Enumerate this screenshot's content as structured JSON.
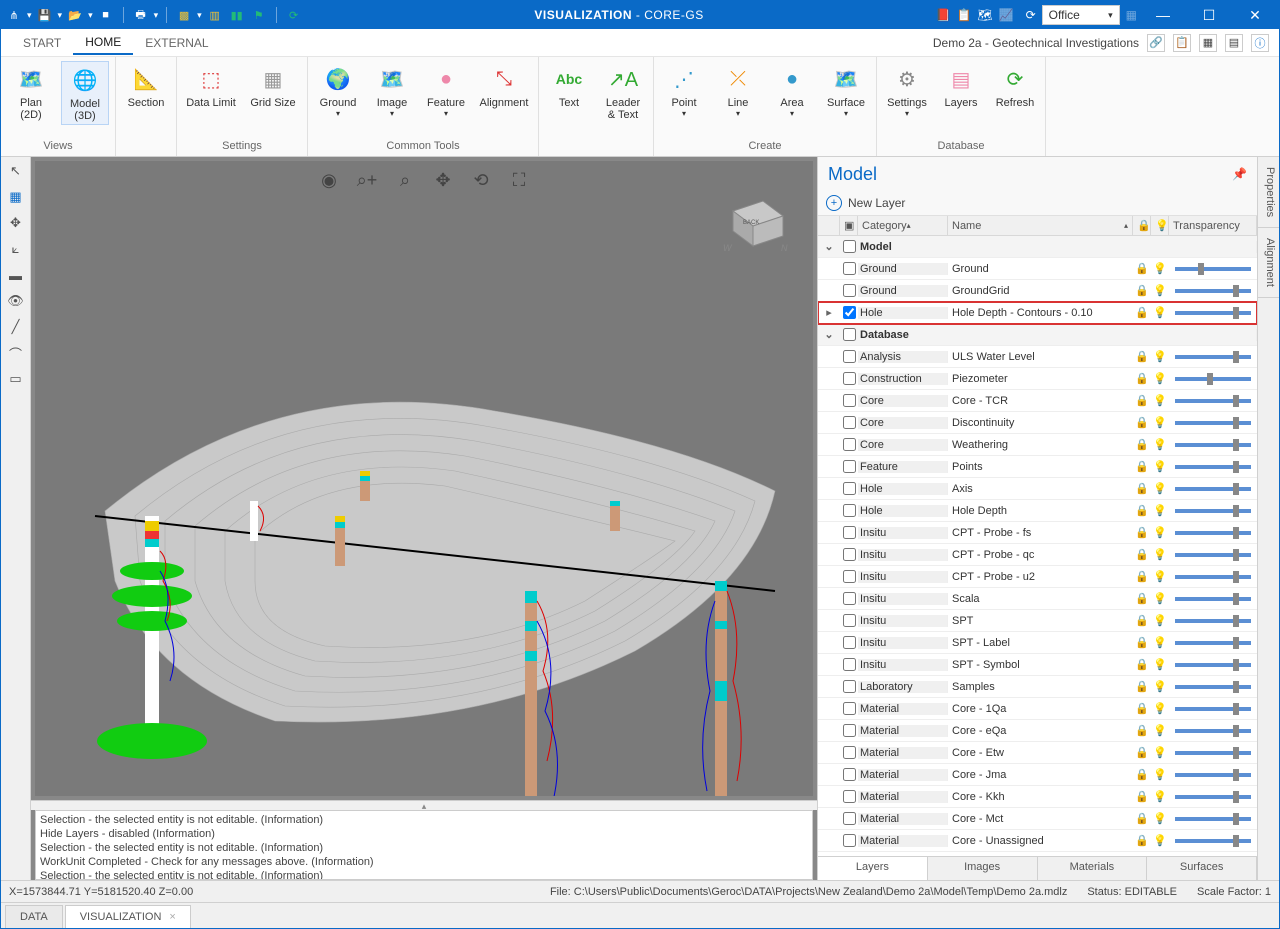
{
  "titlebar": {
    "app": "VISUALIZATION",
    "doc": "- CORE-GS",
    "theme": "Office"
  },
  "menutabs": {
    "start": "START",
    "home": "HOME",
    "external": "EXTERNAL",
    "docname": "Demo 2a - Geotechnical Investigations"
  },
  "ribbon": {
    "views": {
      "label": "Views",
      "plan2d": "Plan\n(2D)",
      "model3d": "Model\n(3D)",
      "section": "Section"
    },
    "settings": {
      "label": "Settings",
      "datalimit": "Data Limit",
      "gridsize": "Grid Size"
    },
    "commontools": {
      "label": "Common Tools",
      "ground": "Ground",
      "image": "Image",
      "feature": "Feature",
      "alignment": "Alignment"
    },
    "create": {
      "label": "Create",
      "text": "Text",
      "leader": "Leader\n& Text",
      "point": "Point",
      "line": "Line",
      "area": "Area",
      "surface": "Surface"
    },
    "database": {
      "label": "Database",
      "settings": "Settings",
      "layers": "Layers",
      "refresh": "Refresh"
    }
  },
  "rightpanel": {
    "title": "Model",
    "newlayer": "New Layer",
    "cols": {
      "category": "Category",
      "name": "Name",
      "transparency": "Transparency"
    },
    "groups": {
      "model": "Model",
      "database": "Database"
    },
    "rows_model": [
      {
        "cat": "Ground",
        "name": "Ground",
        "bulb": false,
        "thumb": 40
      },
      {
        "cat": "Ground",
        "name": "GroundGrid",
        "bulb": true,
        "thumb": 100
      },
      {
        "cat": "Hole",
        "name": "Hole Depth - Contours - 0.10",
        "bulb": true,
        "thumb": 100,
        "checked": true,
        "highlight": true
      }
    ],
    "rows_db": [
      {
        "cat": "Analysis",
        "name": "ULS Water Level",
        "bulb": false,
        "thumb": 100
      },
      {
        "cat": "Construction",
        "name": "Piezometer",
        "bulb": true,
        "thumb": 55
      },
      {
        "cat": "Core",
        "name": "Core - TCR",
        "bulb": true,
        "thumb": 100
      },
      {
        "cat": "Core",
        "name": "Discontinuity",
        "bulb": true,
        "thumb": 100
      },
      {
        "cat": "Core",
        "name": "Weathering",
        "bulb": true,
        "thumb": 100
      },
      {
        "cat": "Feature",
        "name": "Points",
        "bulb": true,
        "thumb": 100
      },
      {
        "cat": "Hole",
        "name": "Axis",
        "bulb": true,
        "thumb": 100
      },
      {
        "cat": "Hole",
        "name": "Hole Depth",
        "bulb": false,
        "thumb": 100
      },
      {
        "cat": "Insitu",
        "name": "CPT - Probe - fs",
        "bulb": true,
        "thumb": 100
      },
      {
        "cat": "Insitu",
        "name": "CPT - Probe - qc",
        "bulb": true,
        "thumb": 100
      },
      {
        "cat": "Insitu",
        "name": "CPT - Probe - u2",
        "bulb": true,
        "thumb": 100
      },
      {
        "cat": "Insitu",
        "name": "Scala",
        "bulb": true,
        "thumb": 100
      },
      {
        "cat": "Insitu",
        "name": "SPT",
        "bulb": true,
        "thumb": 100
      },
      {
        "cat": "Insitu",
        "name": "SPT - Label",
        "bulb": true,
        "thumb": 100
      },
      {
        "cat": "Insitu",
        "name": "SPT - Symbol",
        "bulb": true,
        "thumb": 100
      },
      {
        "cat": "Laboratory",
        "name": "Samples",
        "bulb": true,
        "thumb": 100
      },
      {
        "cat": "Material",
        "name": "Core - 1Qa",
        "bulb": true,
        "thumb": 100
      },
      {
        "cat": "Material",
        "name": "Core - eQa",
        "bulb": true,
        "thumb": 100
      },
      {
        "cat": "Material",
        "name": "Core - Etw",
        "bulb": true,
        "thumb": 100
      },
      {
        "cat": "Material",
        "name": "Core - Jma",
        "bulb": true,
        "thumb": 100
      },
      {
        "cat": "Material",
        "name": "Core - Kkh",
        "bulb": true,
        "thumb": 100
      },
      {
        "cat": "Material",
        "name": "Core - Mct",
        "bulb": true,
        "thumb": 100
      },
      {
        "cat": "Material",
        "name": "Core - Unassigned",
        "bulb": true,
        "thumb": 100
      }
    ],
    "tabs": {
      "layers": "Layers",
      "images": "Images",
      "materials": "Materials",
      "surfaces": "Surfaces"
    }
  },
  "side": {
    "properties": "Properties",
    "alignment": "Alignment"
  },
  "messages": [
    "Selection - the selected entity is not editable. (Information)",
    "Hide Layers - disabled (Information)",
    "Selection - the selected entity is not editable. (Information)",
    "WorkUnit Completed - Check for any messages above. (Information)",
    "Selection - the selected entity is not editable. (Information)"
  ],
  "status": {
    "coords": "X=1573844.71    Y=5181520.40    Z=0.00",
    "file": "File: C:\\Users\\Public\\Documents\\Geroc\\DATA\\Projects\\New Zealand\\Demo 2a\\Model\\Temp\\Demo 2a.mdlz",
    "state": "Status: EDITABLE",
    "scale": "Scale Factor: 1"
  },
  "doctabs": {
    "data": "DATA",
    "viz": "VISUALIZATION"
  },
  "abc": "Abc"
}
